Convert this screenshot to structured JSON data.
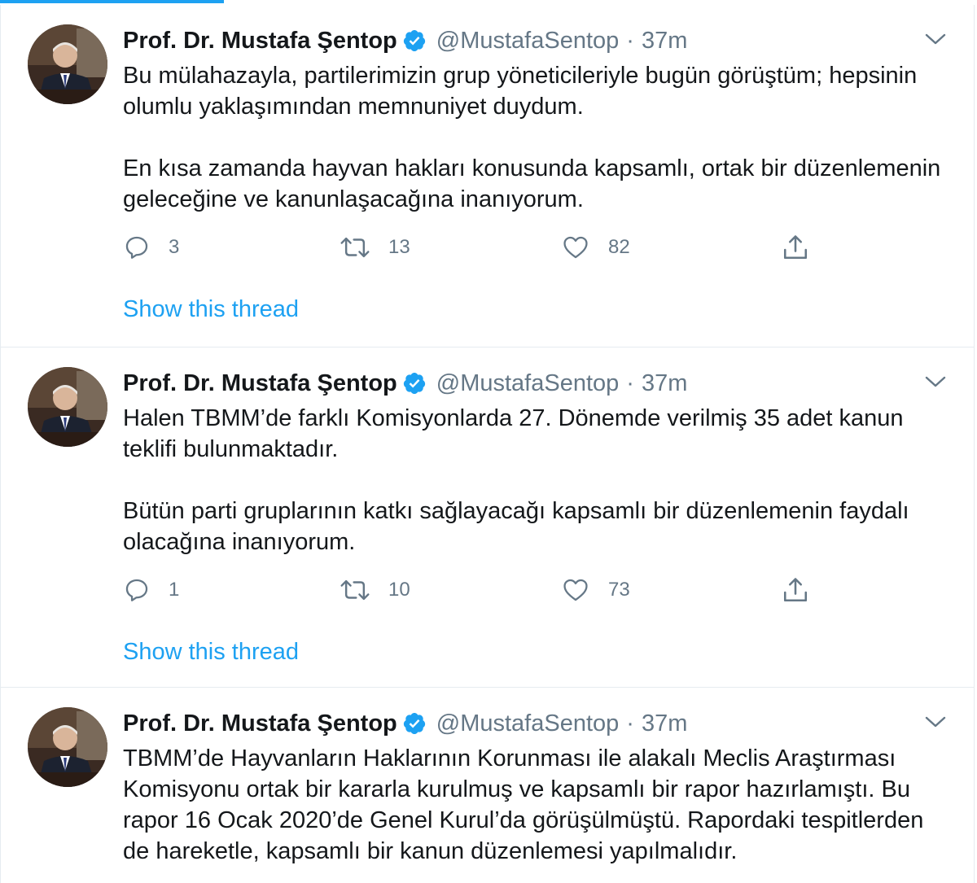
{
  "tweets": [
    {
      "author_name": "Prof. Dr. Mustafa Şentop",
      "handle": "@MustafaSentop",
      "separator": "·",
      "time": "37m",
      "paragraphs": [
        "Bu mülahazayla, partilerimizin grup yöneticileriyle bugün görüştüm; hepsinin\nolumlu yaklaşımından memnuniyet duydum.",
        "En kısa zamanda hayvan hakları konusunda kapsamlı, ortak bir düzenlemenin\ngeleceğine ve kanunlaşacağına inanıyorum."
      ],
      "replies": "3",
      "retweets": "13",
      "likes": "82",
      "show_thread": "Show this thread"
    },
    {
      "author_name": "Prof. Dr. Mustafa Şentop",
      "handle": "@MustafaSentop",
      "separator": "·",
      "time": "37m",
      "paragraphs": [
        "Halen TBMM’de farklı Komisyonlarda 27. Dönemde verilmiş 35 adet kanun\nteklifi bulunmaktadır.",
        "Bütün parti gruplarının katkı sağlayacağı kapsamlı bir düzenlemenin faydalı\nolacağına inanıyorum."
      ],
      "replies": "1",
      "retweets": "10",
      "likes": "73",
      "show_thread": "Show this thread"
    },
    {
      "author_name": "Prof. Dr. Mustafa Şentop",
      "handle": "@MustafaSentop",
      "separator": "·",
      "time": "37m",
      "paragraphs": [
        "TBMM’de Hayvanların Haklarının Korunması ile alakalı Meclis Araştırması\nKomisyonu ortak bir kararla kurulmuş ve kapsamlı bir rapor hazırlamıştı. Bu\nrapor 16 Ocak 2020’de Genel Kurul’da görüşülmüştü. Rapordaki tespitlerden\nde hareketle, kapsamlı bir kanun düzenlemesi yapılmalıdır."
      ]
    }
  ],
  "icons": {
    "verified": "verified-badge-icon",
    "more": "chevron-down-icon",
    "reply": "reply-icon",
    "retweet": "retweet-icon",
    "like": "heart-icon",
    "share": "share-icon"
  },
  "colors": {
    "accent": "#1da1f2",
    "text": "#14171a",
    "muted": "#657786",
    "border": "#e6ecf0"
  }
}
